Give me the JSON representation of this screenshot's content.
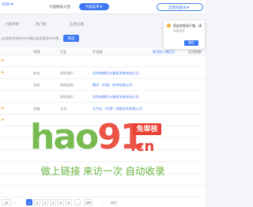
{
  "topbar": {
    "brand_selector": "SEM▼",
    "search_placeholder": "千鹿数据大盘",
    "dropdown_label": "千鹿菜单▼",
    "search_button": "运营商版本▼"
  },
  "subtabs": [
    "小程序榜",
    "热门榜",
    "应用分类"
  ],
  "filters": {
    "options": [
      "按综合排名TOP榜",
      "按运营商TOP榜"
    ],
    "button_label": "筛选"
  },
  "table": {
    "headers": [
      "",
      "领域",
      "行业",
      "开发商",
      "周活跃人数(万)",
      "月活跃数"
    ],
    "rows": [
      {
        "star": true,
        "domain": "",
        "industry": "",
        "developer": ""
      },
      {
        "star": true,
        "domain": "综合",
        "industry": "即时通讯",
        "developer": "深圳市腾讯计算机系统有限公司"
      },
      {
        "star": false,
        "domain": "游戏",
        "industry": "休闲益智",
        "developer": "腾讯（中国）软件有限公司"
      },
      {
        "star": false,
        "domain": "",
        "industry": "即时通讯",
        "developer": "深圳市腾讯计算机系统有限公司"
      },
      {
        "star": true,
        "domain": "金融",
        "industry": "支付",
        "developer": "支付宝（中国）网络技术有限公司"
      },
      {
        "star": true,
        "domain": "",
        "industry": "",
        "developer": ""
      },
      {
        "star": false,
        "domain": "",
        "industry": "",
        "developer": ""
      },
      {
        "star": false,
        "domain": "",
        "industry": "",
        "developer": ""
      },
      {
        "star": false,
        "domain": "",
        "industry": "",
        "developer": ""
      },
      {
        "star": false,
        "domain": "",
        "industry": "",
        "developer": ""
      },
      {
        "star": false,
        "domain": "",
        "industry": "",
        "developer": ""
      },
      {
        "star": false,
        "domain": "",
        "industry": "",
        "developer": ""
      }
    ]
  },
  "popup": {
    "message": "您此前登录千鹿，请",
    "sub_message": "续费会员",
    "ok_label": "确定"
  },
  "watermark": {
    "logo_text_a": "hao",
    "logo_text_b": "91",
    "logo_domain": ".cn",
    "badge": "免审核",
    "slogan": "做上链接 来访一次 自动收录"
  },
  "pager": {
    "page_size": "10",
    "pages": [
      "1",
      "2",
      "3",
      "4",
      "5",
      "6",
      "...",
      "100"
    ],
    "active_page": "1",
    "goto_label": "前往"
  },
  "colors": {
    "accent": "#3d78f4",
    "star": "#f5a623",
    "watermark_green": "#6ab53f",
    "watermark_red": "#e94234"
  }
}
